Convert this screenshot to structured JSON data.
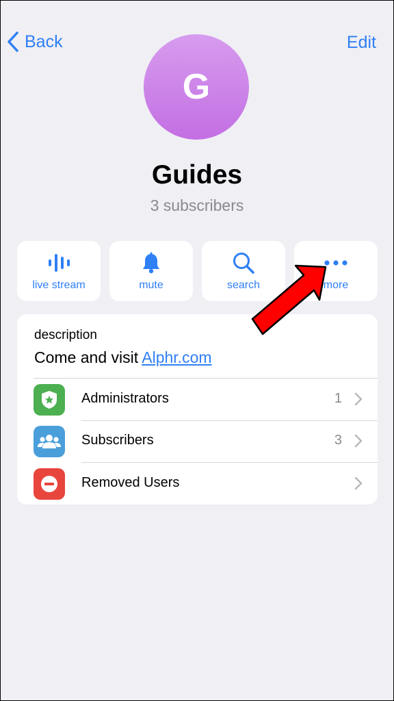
{
  "nav": {
    "back_label": "Back",
    "edit_label": "Edit"
  },
  "channel": {
    "avatar_letter": "G",
    "name": "Guides",
    "subscribers_text": "3 subscribers",
    "avatar_gradient": [
      "#d79cee",
      "#c36fe3"
    ]
  },
  "actions": [
    {
      "label": "live stream",
      "icon": "live-stream-icon"
    },
    {
      "label": "mute",
      "icon": "bell-icon"
    },
    {
      "label": "search",
      "icon": "search-icon"
    },
    {
      "label": "more",
      "icon": "more-dots-icon"
    }
  ],
  "info": {
    "description_label": "description",
    "description_text": "Come and visit ",
    "description_link": "Alphr.com"
  },
  "rows": [
    {
      "label": "Administrators",
      "count": "1",
      "icon": "admin-badge-icon",
      "color": "#4caf50"
    },
    {
      "label": "Subscribers",
      "count": "3",
      "icon": "people-icon",
      "color": "#4a9fda"
    },
    {
      "label": "Removed Users",
      "count": "",
      "icon": "minus-circle-icon",
      "color": "#e8453c"
    }
  ],
  "colors": {
    "accent": "#2f7ff5",
    "background": "#efeff4",
    "annotation_arrow": "#ff0000"
  }
}
